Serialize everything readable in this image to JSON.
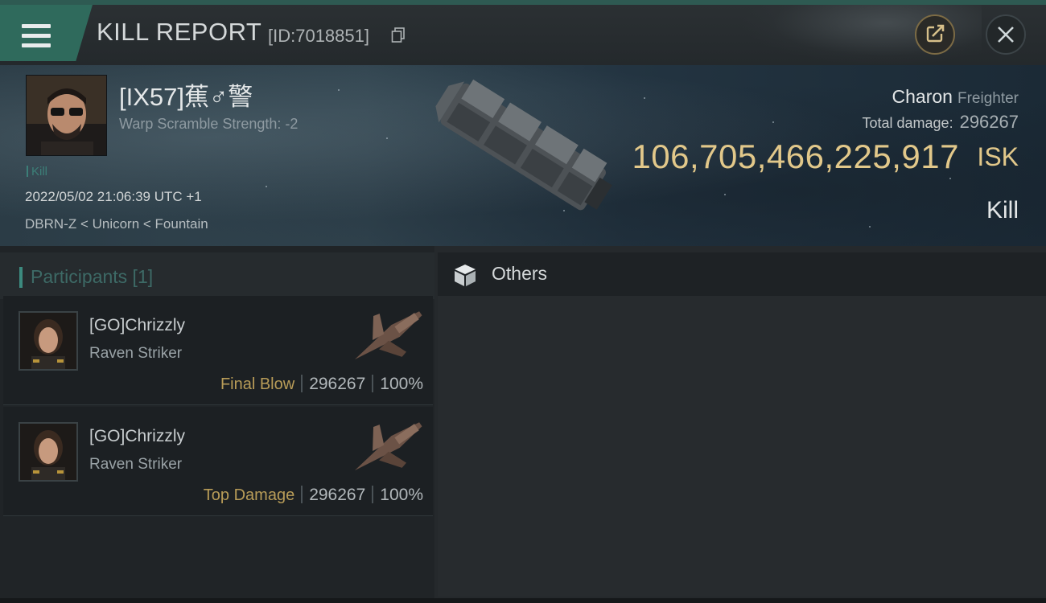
{
  "header": {
    "title": "KILL REPORT",
    "report_id": "[ID:7018851]",
    "icons": {
      "menu": "menu-icon",
      "copy": "copy-icon",
      "share": "share-icon",
      "close": "close-icon"
    }
  },
  "victim": {
    "name": "[IX57]蕉♂警",
    "warp_scramble": "Warp Scramble Strength: -2",
    "kill_tag": "Kill",
    "datetime": "2022/05/02 21:06:39 UTC +1",
    "location": "DBRN-Z < Unicorn < Fountain"
  },
  "ship": {
    "name": "Charon",
    "class": "Freighter",
    "total_damage_label": "Total damage:",
    "total_damage": "296267",
    "isk_value": "106,705,466,225,917",
    "isk_unit": "ISK",
    "result": "Kill"
  },
  "participants": {
    "label": "Participants [1]",
    "rows": [
      {
        "name": "[GO]Chrizzly",
        "ship": "Raven Striker",
        "tag": "Final Blow",
        "damage": "296267",
        "percent": "100%"
      },
      {
        "name": "[GO]Chrizzly",
        "ship": "Raven Striker",
        "tag": "Top Damage",
        "damage": "296267",
        "percent": "100%"
      }
    ]
  },
  "others": {
    "label": "Others",
    "icon": "box-icon"
  },
  "colors": {
    "accent": "#2f6a5c",
    "isk_gold": "#e2c88a",
    "tag_gold": "#b89c58"
  }
}
